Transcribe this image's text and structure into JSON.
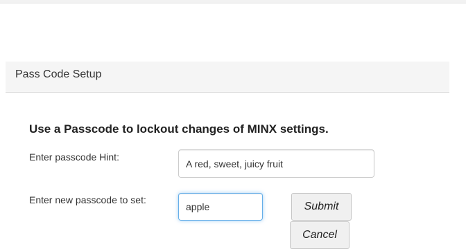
{
  "panel": {
    "title": "Pass Code Setup"
  },
  "form": {
    "heading": "Use a Passcode to lockout changes of MINX settings.",
    "hint_label": "Enter passcode Hint:",
    "hint_value": "A red, sweet, juicy fruit",
    "new_label": "Enter new passcode to set:",
    "new_value": "apple",
    "submit_label": "Submit",
    "cancel_label": "Cancel"
  },
  "colors": {
    "header_bg": "#f5f5f5",
    "focus_border": "#66afe9",
    "button_bg": "#f0f0f0"
  }
}
